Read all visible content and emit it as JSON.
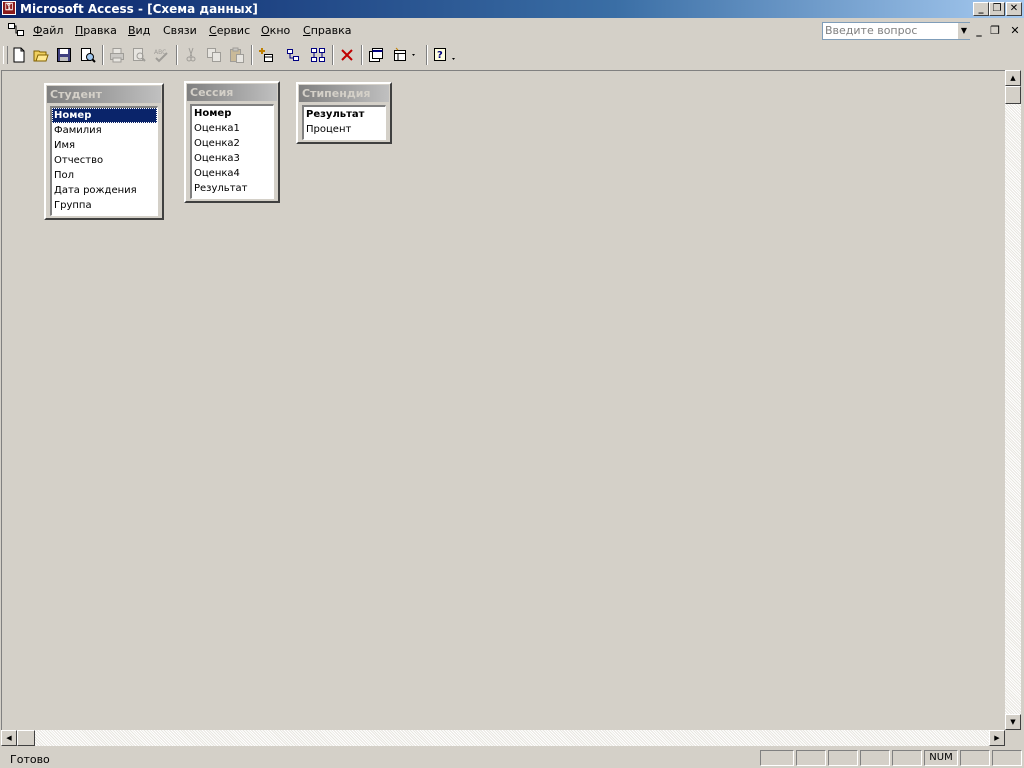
{
  "titlebar": {
    "title": "Microsoft Access - [Схема данных]",
    "minimize": "_",
    "restore": "❐",
    "close": "✕"
  },
  "menu": {
    "items": [
      {
        "mnemonic": "Ф",
        "rest": "айл"
      },
      {
        "mnemonic": "П",
        "rest": "равка"
      },
      {
        "mnemonic": "В",
        "rest": "ид"
      },
      {
        "mnemonic": "",
        "rest": "Связи"
      },
      {
        "mnemonic": "С",
        "rest": "ервис"
      },
      {
        "mnemonic": "О",
        "rest": "кно"
      },
      {
        "mnemonic": "С",
        "rest": "правка"
      }
    ],
    "ask_placeholder": "Введите вопрос",
    "doc_minimize": "_",
    "doc_restore": "❐",
    "doc_close": "✕"
  },
  "toolbar": {
    "buttons": [
      "new-icon",
      "open-icon",
      "save-icon",
      "search-icon",
      "print-icon",
      "print-preview-icon",
      "spelling-icon",
      "cut-icon",
      "copy-icon",
      "paste-icon",
      "show-table-icon",
      "show-direct-icon",
      "show-all-icon",
      "delete-icon",
      "properties-icon",
      "new-object-icon",
      "help-icon"
    ]
  },
  "tables": {
    "student": {
      "title": "Студент",
      "fields": [
        "Номер",
        "Фамилия",
        "Имя",
        "Отчество",
        "Пол",
        "Дата рождения",
        "Группа"
      ]
    },
    "session": {
      "title": "Сессия",
      "fields": [
        "Номер",
        "Оценка1",
        "Оценка2",
        "Оценка3",
        "Оценка4",
        "Результат"
      ]
    },
    "scholarship": {
      "title": "Стипендия",
      "fields": [
        "Результат",
        "Процент"
      ]
    }
  },
  "status": {
    "text": "Готово",
    "num": "NUM"
  },
  "colors": {
    "title_start": "#0a246a",
    "title_end": "#a6caf0",
    "workspace": "#d4d0c8",
    "selection": "#0a246a"
  }
}
